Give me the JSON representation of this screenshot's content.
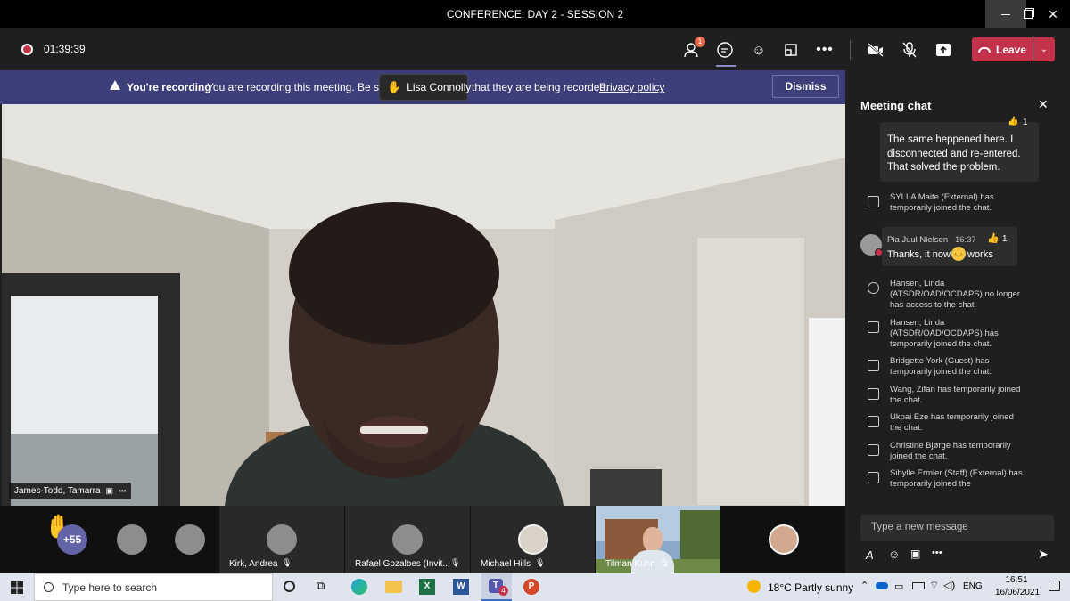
{
  "window": {
    "title": "CONFERENCE: DAY 2 - SESSION 2"
  },
  "toolbar": {
    "timer": "01:39:39",
    "participants_badge": "1",
    "leave_label": "Leave"
  },
  "banner": {
    "title": "You're recording",
    "text_before": "You are recording this meeting. Be sure",
    "text_after": "that they are being recorded.",
    "link": "Privacy policy",
    "dismiss_label": "Dismiss",
    "raised_hand_name": "Lisa Connolly"
  },
  "main_video": {
    "name": "James-Todd, Tamarra"
  },
  "chat": {
    "title": "Meeting chat",
    "reaction_count_top": "1",
    "message_top": "The same heppened here. I disconnected and re-entered. That solved the problem.",
    "sys1": "SYLLA Maite (External) has temporarily joined the chat.",
    "msg_author": "Pia Juul Nielsen",
    "msg_time": "16:37",
    "msg_reaction_count": "1",
    "msg_text_before": "Thanks, it now",
    "msg_text_after": "works",
    "sys2": "Hansen, Linda (ATSDR/OAD/OCDAPS) no longer has access to the chat.",
    "sys3": "Hansen, Linda (ATSDR/OAD/OCDAPS) has temporarily joined the chat.",
    "sys4": "Bridgette York (Guest) has temporarily joined the chat.",
    "sys5": "Wang, Zifan has temporarily joined the chat.",
    "sys6": "Ukpai Eze has temporarily joined the chat.",
    "sys7": "Christine Bjørge has temporarily joined the chat.",
    "sys8": "Sibylle Ermler (Staff) (External) has temporarily joined the",
    "compose_placeholder": "Type a new message"
  },
  "strip": {
    "overflow_count": "+55",
    "tile1": "Kirk, Andrea",
    "tile2": "Rafael Gozalbes (Invit...",
    "tile3": "Michael Hills",
    "tile4": "Tilman Kuhn"
  },
  "taskbar": {
    "search_placeholder": "Type here to search",
    "teams_badge": "4",
    "weather": "18°C  Partly sunny",
    "lang": "ENG",
    "time": "16:51",
    "date": "16/06/2021"
  },
  "colors": {
    "leave": "#c4314b",
    "banner": "#3d3f7a",
    "accent": "#6264a7",
    "badge": "#e8674a"
  }
}
